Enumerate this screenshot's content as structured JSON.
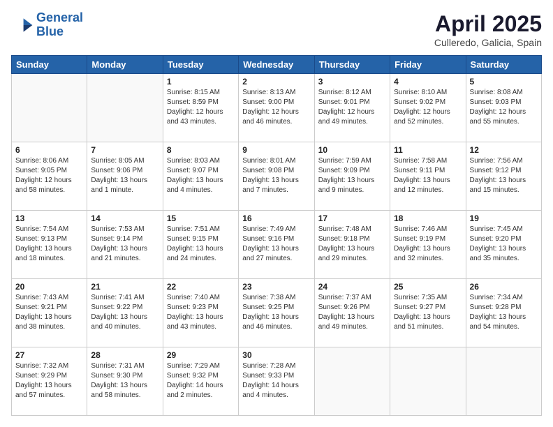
{
  "logo": {
    "line1": "General",
    "line2": "Blue"
  },
  "title": "April 2025",
  "subtitle": "Culleredo, Galicia, Spain",
  "weekdays": [
    "Sunday",
    "Monday",
    "Tuesday",
    "Wednesday",
    "Thursday",
    "Friday",
    "Saturday"
  ],
  "weeks": [
    [
      {
        "day": "",
        "info": ""
      },
      {
        "day": "",
        "info": ""
      },
      {
        "day": "1",
        "info": "Sunrise: 8:15 AM\nSunset: 8:59 PM\nDaylight: 12 hours and 43 minutes."
      },
      {
        "day": "2",
        "info": "Sunrise: 8:13 AM\nSunset: 9:00 PM\nDaylight: 12 hours and 46 minutes."
      },
      {
        "day": "3",
        "info": "Sunrise: 8:12 AM\nSunset: 9:01 PM\nDaylight: 12 hours and 49 minutes."
      },
      {
        "day": "4",
        "info": "Sunrise: 8:10 AM\nSunset: 9:02 PM\nDaylight: 12 hours and 52 minutes."
      },
      {
        "day": "5",
        "info": "Sunrise: 8:08 AM\nSunset: 9:03 PM\nDaylight: 12 hours and 55 minutes."
      }
    ],
    [
      {
        "day": "6",
        "info": "Sunrise: 8:06 AM\nSunset: 9:05 PM\nDaylight: 12 hours and 58 minutes."
      },
      {
        "day": "7",
        "info": "Sunrise: 8:05 AM\nSunset: 9:06 PM\nDaylight: 13 hours and 1 minute."
      },
      {
        "day": "8",
        "info": "Sunrise: 8:03 AM\nSunset: 9:07 PM\nDaylight: 13 hours and 4 minutes."
      },
      {
        "day": "9",
        "info": "Sunrise: 8:01 AM\nSunset: 9:08 PM\nDaylight: 13 hours and 7 minutes."
      },
      {
        "day": "10",
        "info": "Sunrise: 7:59 AM\nSunset: 9:09 PM\nDaylight: 13 hours and 9 minutes."
      },
      {
        "day": "11",
        "info": "Sunrise: 7:58 AM\nSunset: 9:11 PM\nDaylight: 13 hours and 12 minutes."
      },
      {
        "day": "12",
        "info": "Sunrise: 7:56 AM\nSunset: 9:12 PM\nDaylight: 13 hours and 15 minutes."
      }
    ],
    [
      {
        "day": "13",
        "info": "Sunrise: 7:54 AM\nSunset: 9:13 PM\nDaylight: 13 hours and 18 minutes."
      },
      {
        "day": "14",
        "info": "Sunrise: 7:53 AM\nSunset: 9:14 PM\nDaylight: 13 hours and 21 minutes."
      },
      {
        "day": "15",
        "info": "Sunrise: 7:51 AM\nSunset: 9:15 PM\nDaylight: 13 hours and 24 minutes."
      },
      {
        "day": "16",
        "info": "Sunrise: 7:49 AM\nSunset: 9:16 PM\nDaylight: 13 hours and 27 minutes."
      },
      {
        "day": "17",
        "info": "Sunrise: 7:48 AM\nSunset: 9:18 PM\nDaylight: 13 hours and 29 minutes."
      },
      {
        "day": "18",
        "info": "Sunrise: 7:46 AM\nSunset: 9:19 PM\nDaylight: 13 hours and 32 minutes."
      },
      {
        "day": "19",
        "info": "Sunrise: 7:45 AM\nSunset: 9:20 PM\nDaylight: 13 hours and 35 minutes."
      }
    ],
    [
      {
        "day": "20",
        "info": "Sunrise: 7:43 AM\nSunset: 9:21 PM\nDaylight: 13 hours and 38 minutes."
      },
      {
        "day": "21",
        "info": "Sunrise: 7:41 AM\nSunset: 9:22 PM\nDaylight: 13 hours and 40 minutes."
      },
      {
        "day": "22",
        "info": "Sunrise: 7:40 AM\nSunset: 9:23 PM\nDaylight: 13 hours and 43 minutes."
      },
      {
        "day": "23",
        "info": "Sunrise: 7:38 AM\nSunset: 9:25 PM\nDaylight: 13 hours and 46 minutes."
      },
      {
        "day": "24",
        "info": "Sunrise: 7:37 AM\nSunset: 9:26 PM\nDaylight: 13 hours and 49 minutes."
      },
      {
        "day": "25",
        "info": "Sunrise: 7:35 AM\nSunset: 9:27 PM\nDaylight: 13 hours and 51 minutes."
      },
      {
        "day": "26",
        "info": "Sunrise: 7:34 AM\nSunset: 9:28 PM\nDaylight: 13 hours and 54 minutes."
      }
    ],
    [
      {
        "day": "27",
        "info": "Sunrise: 7:32 AM\nSunset: 9:29 PM\nDaylight: 13 hours and 57 minutes."
      },
      {
        "day": "28",
        "info": "Sunrise: 7:31 AM\nSunset: 9:30 PM\nDaylight: 13 hours and 58 minutes."
      },
      {
        "day": "29",
        "info": "Sunrise: 7:29 AM\nSunset: 9:32 PM\nDaylight: 14 hours and 2 minutes."
      },
      {
        "day": "30",
        "info": "Sunrise: 7:28 AM\nSunset: 9:33 PM\nDaylight: 14 hours and 4 minutes."
      },
      {
        "day": "",
        "info": ""
      },
      {
        "day": "",
        "info": ""
      },
      {
        "day": "",
        "info": ""
      }
    ]
  ]
}
